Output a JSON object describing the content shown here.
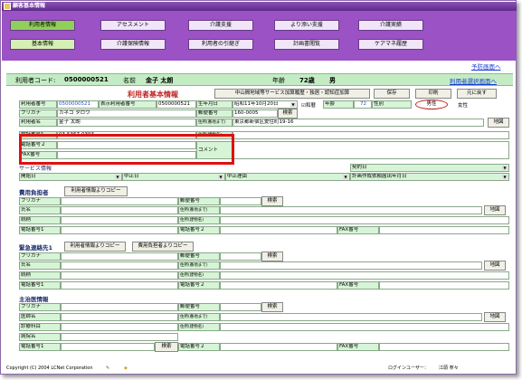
{
  "window": {
    "title": "顧客基本情報"
  },
  "top_tabs": [
    "利用者情報",
    "アセスメント",
    "介護支援",
    "より添い支援",
    "介護実績"
  ],
  "sub_tabs": [
    "基本情報",
    "介護保険情報",
    "利用者の引継ぎ",
    "計画書閲覧",
    "ケアマネ履歴"
  ],
  "links": {
    "yobou": "予防画面へ",
    "riyousha_select": "利用者選択画面へ"
  },
  "header": {
    "code_label": "利用者コード:",
    "code_value": "0500000521",
    "name_label": "名前",
    "name_value": "金子 太朗",
    "age_label": "年齢",
    "age_value": "72歳",
    "sex_value": "男"
  },
  "section_title": "利用者基本情報",
  "buttons": {
    "history": "中山間地域等サービス加算履歴・独居・認知症加算",
    "save": "保存",
    "print": "印刷",
    "back": "元に戻す",
    "search": "検索",
    "map": "地図",
    "copy_user": "利用者情報よりコピー",
    "copy_payer": "費用負担者よりコピー"
  },
  "basic": {
    "user_no_label": "利用者番号",
    "user_no": "0500000521",
    "disp_no_label": "表示利用者番号",
    "disp_no": "0500000521",
    "birth_label": "生年月日",
    "birth": "昭和11年10月20日",
    "wareki": "和暦",
    "age_label": "年齢",
    "age": "72",
    "sex_label": "性別",
    "male": "男性",
    "female": "女性",
    "furigana_label": "フリガナ",
    "furigana": "カネコ タロウ",
    "name_label": "利用者名",
    "name": "金子 太朗",
    "zip_label": "郵便番号",
    "zip": "160-0005",
    "addr_label": "住所(番地まで)",
    "addr": "東京都新宿区愛住町19-16",
    "bldg_label": "住所(建物名)",
    "tel1_label": "電話番号1",
    "tel1": "03-5367-0393",
    "tel2_label": "電話番号２",
    "fax_label": "FAX番号",
    "comment_label": "コメント"
  },
  "service": {
    "title": "サービス情報",
    "start_label": "開始日",
    "stop_label": "中止日",
    "reason_label": "中止理由",
    "contract_label": "契約日",
    "plan_label": "計画作成依頼届出年月日"
  },
  "payer": {
    "title": "費用負担者"
  },
  "emergency": {
    "title": "緊急連絡先1"
  },
  "doctor": {
    "title": "主治医情報"
  },
  "form_labels": {
    "furigana": "フリガナ",
    "name": "氏名",
    "relation": "続柄",
    "tel1": "電話番号1",
    "tel2": "電話番号２",
    "zip": "郵便番号",
    "addr": "住所(番地まで)",
    "bldg": "住所(建物名)",
    "fax": "FAX番号",
    "doctor_name": "医師名",
    "dept": "診療科目",
    "hospital": "病院名"
  },
  "status": {
    "copyright": "Copyright (C) 2004 LCNet Corporation",
    "login_label": "ログインユーザー：",
    "login_user": "江頭 寧々"
  }
}
